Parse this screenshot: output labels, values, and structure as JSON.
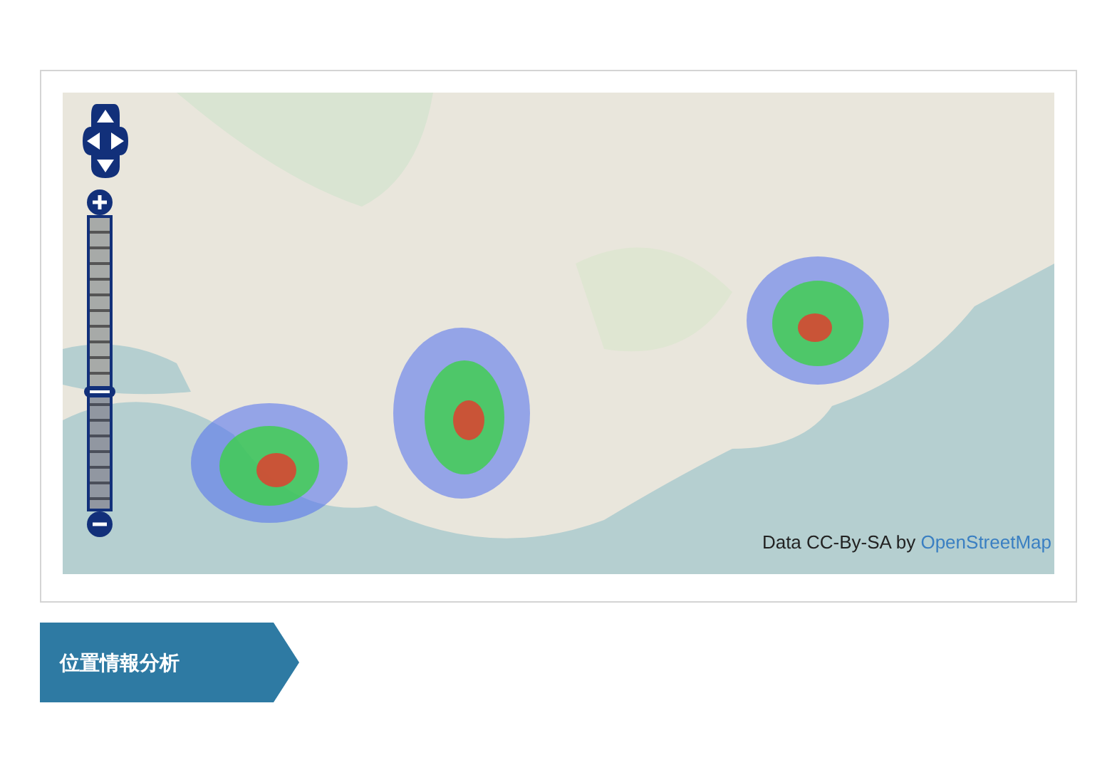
{
  "map": {
    "kind": "picture",
    "zoom_slider": {
      "level": 0.39
    },
    "attribution": {
      "text": "Data CC-By-SA by ",
      "link": "OpenStreetMap"
    }
  },
  "section_heading": "位置情報分析"
}
